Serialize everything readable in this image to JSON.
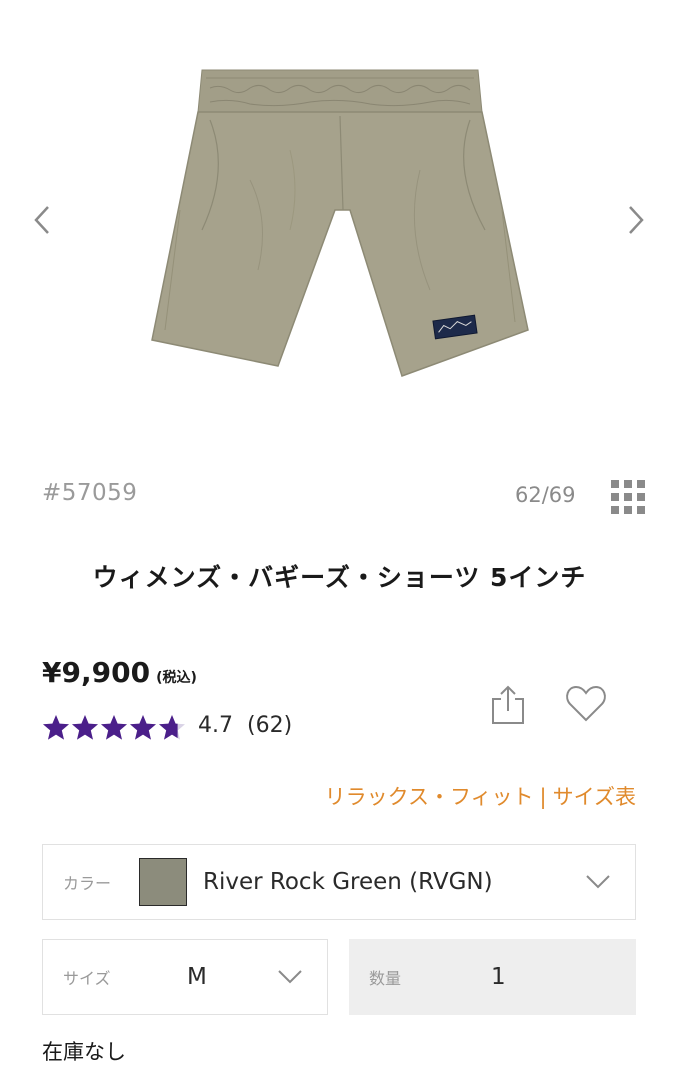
{
  "product": {
    "sku": "#57059",
    "counter": "62/69",
    "title": "ウィメンズ・バギーズ・ショーツ 5インチ",
    "price": "¥9,900",
    "tax_note": "(税込)",
    "rating_value": "4.7",
    "review_count": "(62)",
    "rating_stars": 4.7,
    "stock_status": "在庫なし"
  },
  "links": {
    "fit": "リラックス・フィット",
    "separator": "|",
    "size_chart": "サイズ表"
  },
  "color": {
    "label": "カラー",
    "value": "River Rock Green (RVGN)",
    "swatch_color": "#8c8c7c"
  },
  "size": {
    "label": "サイズ",
    "value": "M"
  },
  "quantity": {
    "label": "数量",
    "value": "1"
  },
  "icons": {
    "prev": "chevron-left-icon",
    "next": "chevron-right-icon",
    "grid": "grid-icon",
    "share": "share-icon",
    "favorite": "heart-icon",
    "dropdown": "chevron-down-icon"
  },
  "colors": {
    "accent": "#e08a2c",
    "star": "#4b1f8a",
    "short_fabric": "#a6a28c"
  }
}
